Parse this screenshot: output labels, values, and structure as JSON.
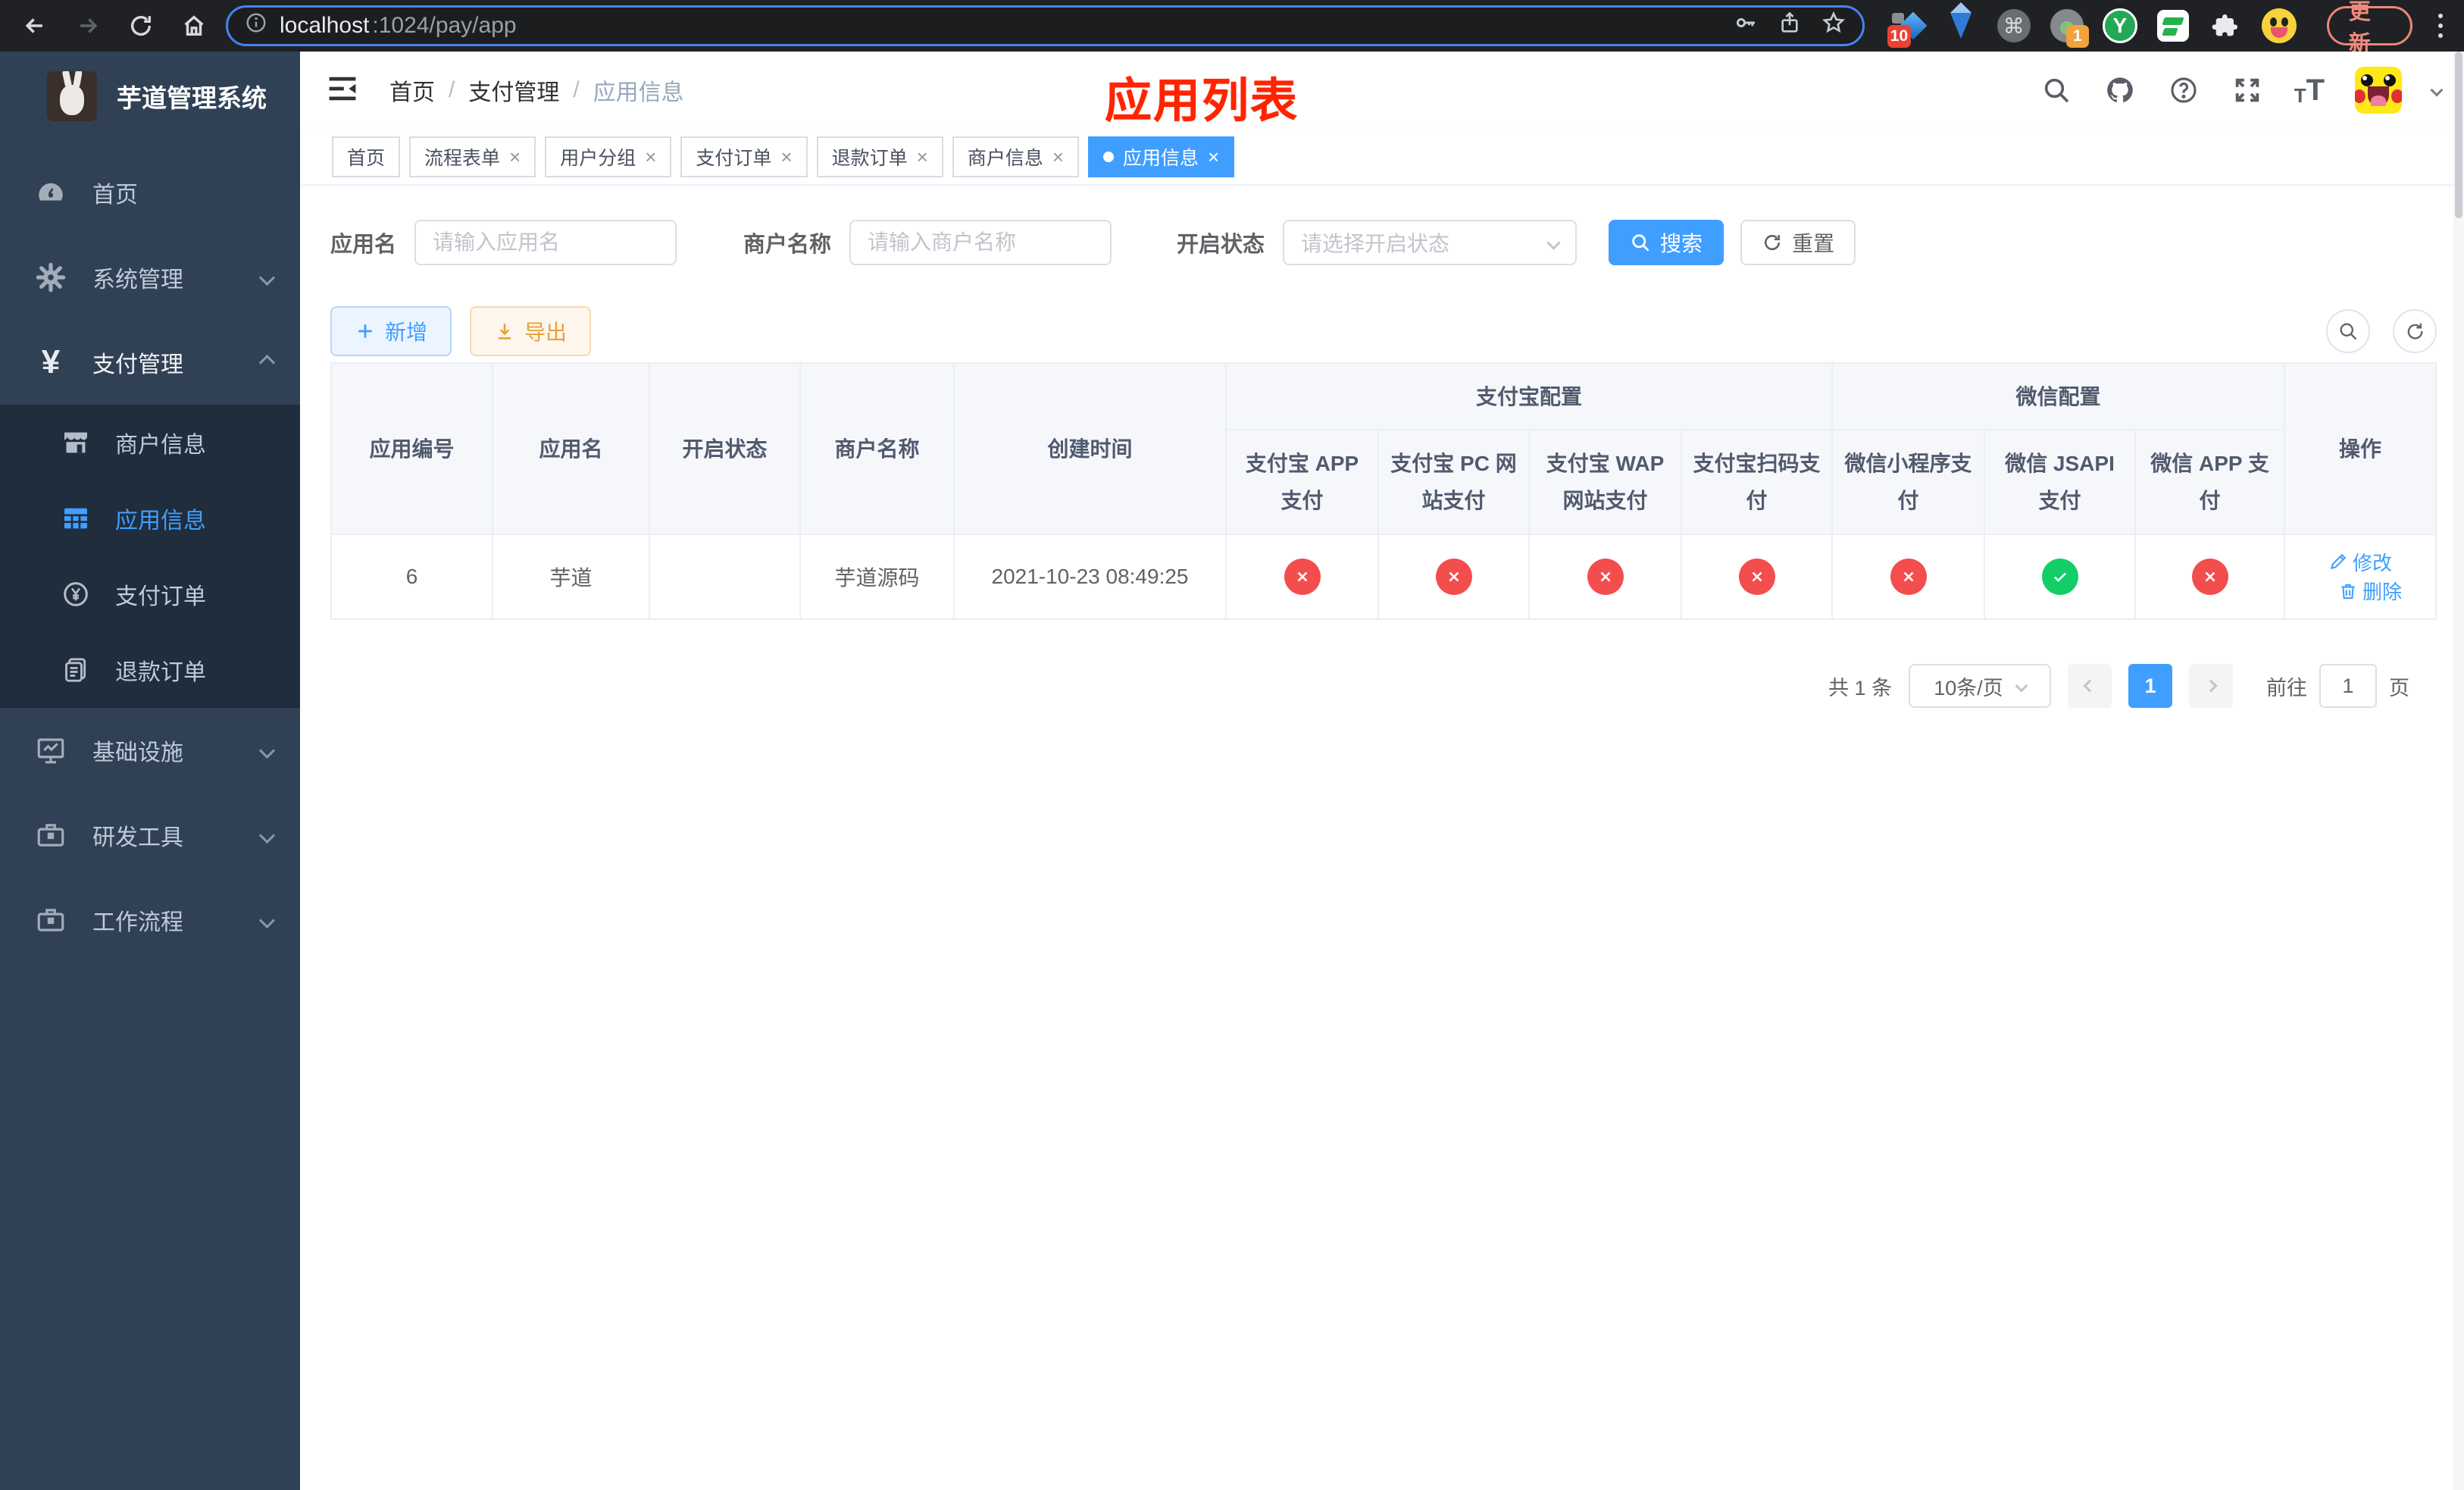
{
  "browser": {
    "url": {
      "host": "localhost",
      "path": ":1024/pay/app"
    },
    "update_button": "更新",
    "badges": {
      "ext1": "10",
      "ext2": "1"
    },
    "command_glyph": "⌘"
  },
  "sidebar": {
    "title": "芋道管理系统",
    "menu": [
      {
        "label": "首页"
      },
      {
        "label": "系统管理"
      },
      {
        "label": "支付管理"
      },
      {
        "label": "基础设施"
      },
      {
        "label": "研发工具"
      },
      {
        "label": "工作流程"
      }
    ],
    "submenu": [
      {
        "label": "商户信息"
      },
      {
        "label": "应用信息"
      },
      {
        "label": "支付订单"
      },
      {
        "label": "退款订单"
      }
    ]
  },
  "header": {
    "breadcrumb": [
      "首页",
      "支付管理",
      "应用信息"
    ],
    "separator": "/",
    "title_overlay": "应用列表"
  },
  "tabs": [
    {
      "label": "首页",
      "closable": false,
      "active": false
    },
    {
      "label": "流程表单",
      "closable": true,
      "active": false
    },
    {
      "label": "用户分组",
      "closable": true,
      "active": false
    },
    {
      "label": "支付订单",
      "closable": true,
      "active": false
    },
    {
      "label": "退款订单",
      "closable": true,
      "active": false
    },
    {
      "label": "商户信息",
      "closable": true,
      "active": false
    },
    {
      "label": "应用信息",
      "closable": true,
      "active": true
    }
  ],
  "ui": {
    "close_glyph": "×"
  },
  "filters": {
    "app_name_label": "应用名",
    "app_name_placeholder": "请输入应用名",
    "merchant_label": "商户名称",
    "merchant_placeholder": "请输入商户名称",
    "status_label": "开启状态",
    "status_placeholder": "请选择开启状态",
    "search_label": "搜索",
    "reset_label": "重置"
  },
  "toolbar": {
    "add_label": "新增",
    "export_label": "导出"
  },
  "table": {
    "columns": {
      "app_id": "应用编号",
      "app_name": "应用名",
      "status": "开启状态",
      "merchant": "商户名称",
      "create_time": "创建时间",
      "alipay_group": "支付宝配置",
      "wechat_group": "微信配置",
      "alipay_app": "支付宝 APP 支付",
      "alipay_pc": "支付宝 PC 网站支付",
      "alipay_wap": "支付宝 WAP 网站支付",
      "alipay_qr": "支付宝扫码支付",
      "wx_lite": "微信小程序支付",
      "wx_jsapi": "微信 JSAPI 支付",
      "wx_app": "微信 APP 支付",
      "action": "操作"
    },
    "rows": [
      {
        "app_id": "6",
        "app_name": "芋道",
        "status_on": true,
        "merchant": "芋道源码",
        "create_time": "2021-10-23 08:49:25",
        "channels": [
          "no",
          "no",
          "no",
          "no",
          "no",
          "yes",
          "no"
        ],
        "edit_label": "修改",
        "delete_label": "删除"
      }
    ]
  },
  "pagination": {
    "total": "共 1 条",
    "page_size": "10条/页",
    "current_page": "1",
    "goto_label": "前往",
    "goto_value": "1",
    "page_suffix": "页"
  },
  "colors": {
    "accent": "#409eff",
    "success": "#13ce66",
    "danger": "#f34d4d",
    "warning": "#e6a23c",
    "sidebar_bg": "#304156",
    "sidebar_sub_bg": "#1f2d3d",
    "annotation_red": "#ff2400"
  }
}
